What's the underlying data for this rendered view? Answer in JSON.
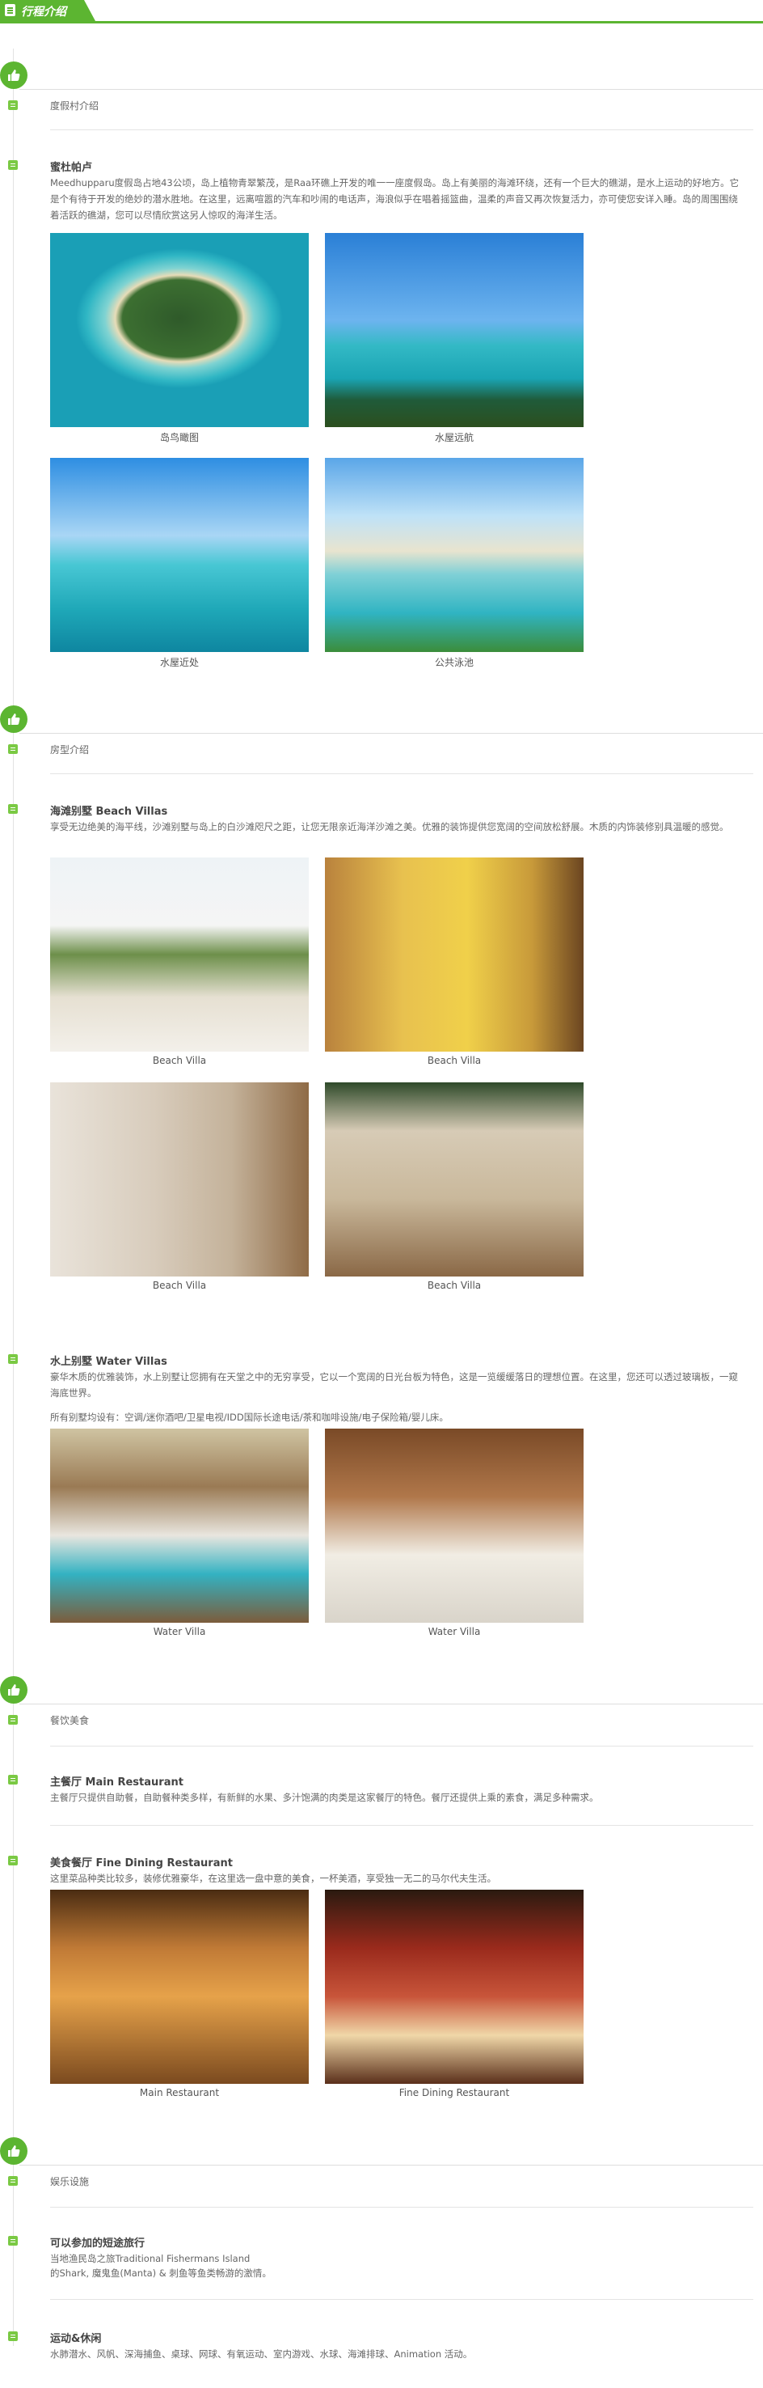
{
  "header": {
    "tab_title": "行程介绍"
  },
  "sections": [
    {
      "title": "度假村介绍",
      "subsections": [
        {
          "title": "蜜杜帕卢",
          "text": "Meedhupparu度假岛占地43公顷，岛上植物青翠繁茂，是Raa环礁上开发的唯一一座度假岛。岛上有美丽的海滩环绕，还有一个巨大的礁湖，是水上运动的好地方。它是个有待于开发的绝妙的潜水胜地。在这里，远离喧嚣的汽车和吵闹的电话声，海浪似乎在唱着摇篮曲，温柔的声音又再次恢复活力，亦可使您安详入睡。岛的周围围绕着活跃的礁湖，您可以尽情欣赏这另人惊叹的海洋生活。",
          "photos": [
            {
              "icon": "island-aerial-photo",
              "caption": "岛鸟瞰图"
            },
            {
              "icon": "water-villa-photo",
              "caption": "水屋远航"
            },
            {
              "icon": "jetty-photo",
              "caption": "水屋近处"
            },
            {
              "icon": "pool-photo",
              "caption": "公共泳池"
            }
          ]
        }
      ]
    },
    {
      "title": "房型介绍",
      "subsections": [
        {
          "title": "海滩别墅 Beach Villas",
          "text": "享受无边绝美的海平线，沙滩别墅与岛上的白沙滩咫尺之距，让您无限亲近海洋沙滩之美。优雅的装饰提供您宽阔的空间放松舒展。木质的内饰装修别具温暖的感觉。",
          "photos": [
            {
              "icon": "beach-villa-exterior-photo",
              "caption": "Beach Villa"
            },
            {
              "icon": "beach-villa-bedroom-photo",
              "caption": "Beach Villa"
            },
            {
              "icon": "beach-villa-bathroom-photo",
              "caption": "Beach Villa"
            },
            {
              "icon": "beach-villa-outdoor-bath-photo",
              "caption": "Beach Villa"
            }
          ]
        },
        {
          "title": "水上别墅 Water Villas",
          "text": "豪华木质的优雅装饰，水上别墅让您拥有在天堂之中的无穷享受，它以一个宽阔的日光台板为特色，这是一览缓缓落日的理想位置。在这里，您还可以透过玻璃板，一窥海底世界。",
          "text2": "所有别墅均设有：空调/迷你酒吧/卫星电视/IDD国际长途电话/茶和咖啡设施/电子保险箱/婴儿床。",
          "photos": [
            {
              "icon": "water-villa-room-photo",
              "caption": "Water Villa"
            },
            {
              "icon": "water-villa-bedroom-photo",
              "caption": "Water Villa"
            }
          ]
        }
      ]
    },
    {
      "title": "餐饮美食",
      "subsections": [
        {
          "title": "主餐厅 Main Restaurant",
          "text": "主餐厅只提供自助餐，自助餐种类多样，有新鲜的水果、多汁饱满的肉类是这家餐厅的特色。餐厅还提供上乘的素食，满足多种需求。"
        },
        {
          "title": "美食餐厅 Fine Dining Restaurant",
          "text": "这里菜品种类比较多，装修优雅豪华，在这里选一盘中意的美食，一杯美酒，享受独一无二的马尔代夫生活。",
          "photos": [
            {
              "icon": "main-restaurant-photo",
              "caption": "Main Restaurant"
            },
            {
              "icon": "fine-dining-photo",
              "caption": "Fine Dining Restaurant"
            }
          ]
        }
      ]
    },
    {
      "title": "娱乐设施",
      "subsections": [
        {
          "title": "可以参加的短途旅行",
          "text": "当地渔民岛之旅Traditional Fishermans Island",
          "text2": "的Shark, 魔鬼鱼(Manta) & 刺鱼等鱼类畅游的激情。"
        },
        {
          "title": "运动&休闲",
          "text": "水肺潜水、风帆、深海捕鱼、桌球、网球、有氧运动、室内游戏、水球、海滩排球、Animation 活动。"
        }
      ]
    }
  ],
  "colors": {
    "accent": "#5cb531",
    "pin": "#7ac943"
  }
}
